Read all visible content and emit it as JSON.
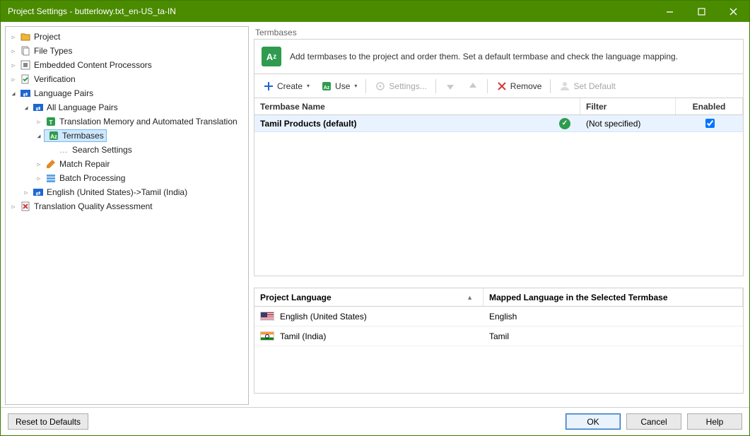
{
  "window": {
    "title": "Project Settings - butterlowy.txt_en-US_ta-IN"
  },
  "tree": {
    "project": "Project",
    "file_types": "File Types",
    "embedded": "Embedded Content Processors",
    "verification": "Verification",
    "language_pairs": "Language Pairs",
    "all_lang_pairs": "All Language Pairs",
    "tm_auto": "Translation Memory and Automated Translation",
    "termbases": "Termbases",
    "search_settings": "Search Settings",
    "match_repair": "Match Repair",
    "batch_processing": "Batch Processing",
    "en_tamil": "English (United States)->Tamil (India)",
    "tqa": "Translation Quality Assessment"
  },
  "main": {
    "section_title": "Termbases",
    "info_text": "Add termbases to the project and order them. Set a default termbase and check the language mapping.",
    "toolbar": {
      "create": "Create",
      "use": "Use",
      "settings": "Settings...",
      "remove": "Remove",
      "set_default": "Set Default"
    },
    "grid1": {
      "h_name": "Termbase Name",
      "h_filter": "Filter",
      "h_enabled": "Enabled",
      "rows": [
        {
          "name": "Tamil Products (default)",
          "filter": "(Not specified)",
          "enabled": true,
          "ok": true
        }
      ]
    },
    "grid2": {
      "h_plang": "Project Language",
      "h_mlang": "Mapped Language in the Selected Termbase",
      "rows": [
        {
          "plang": "English (United States)",
          "mlang": "English",
          "flag": "us"
        },
        {
          "plang": "Tamil (India)",
          "mlang": "Tamil",
          "flag": "in"
        }
      ]
    }
  },
  "footer": {
    "reset": "Reset to Defaults",
    "ok": "OK",
    "cancel": "Cancel",
    "help": "Help"
  }
}
